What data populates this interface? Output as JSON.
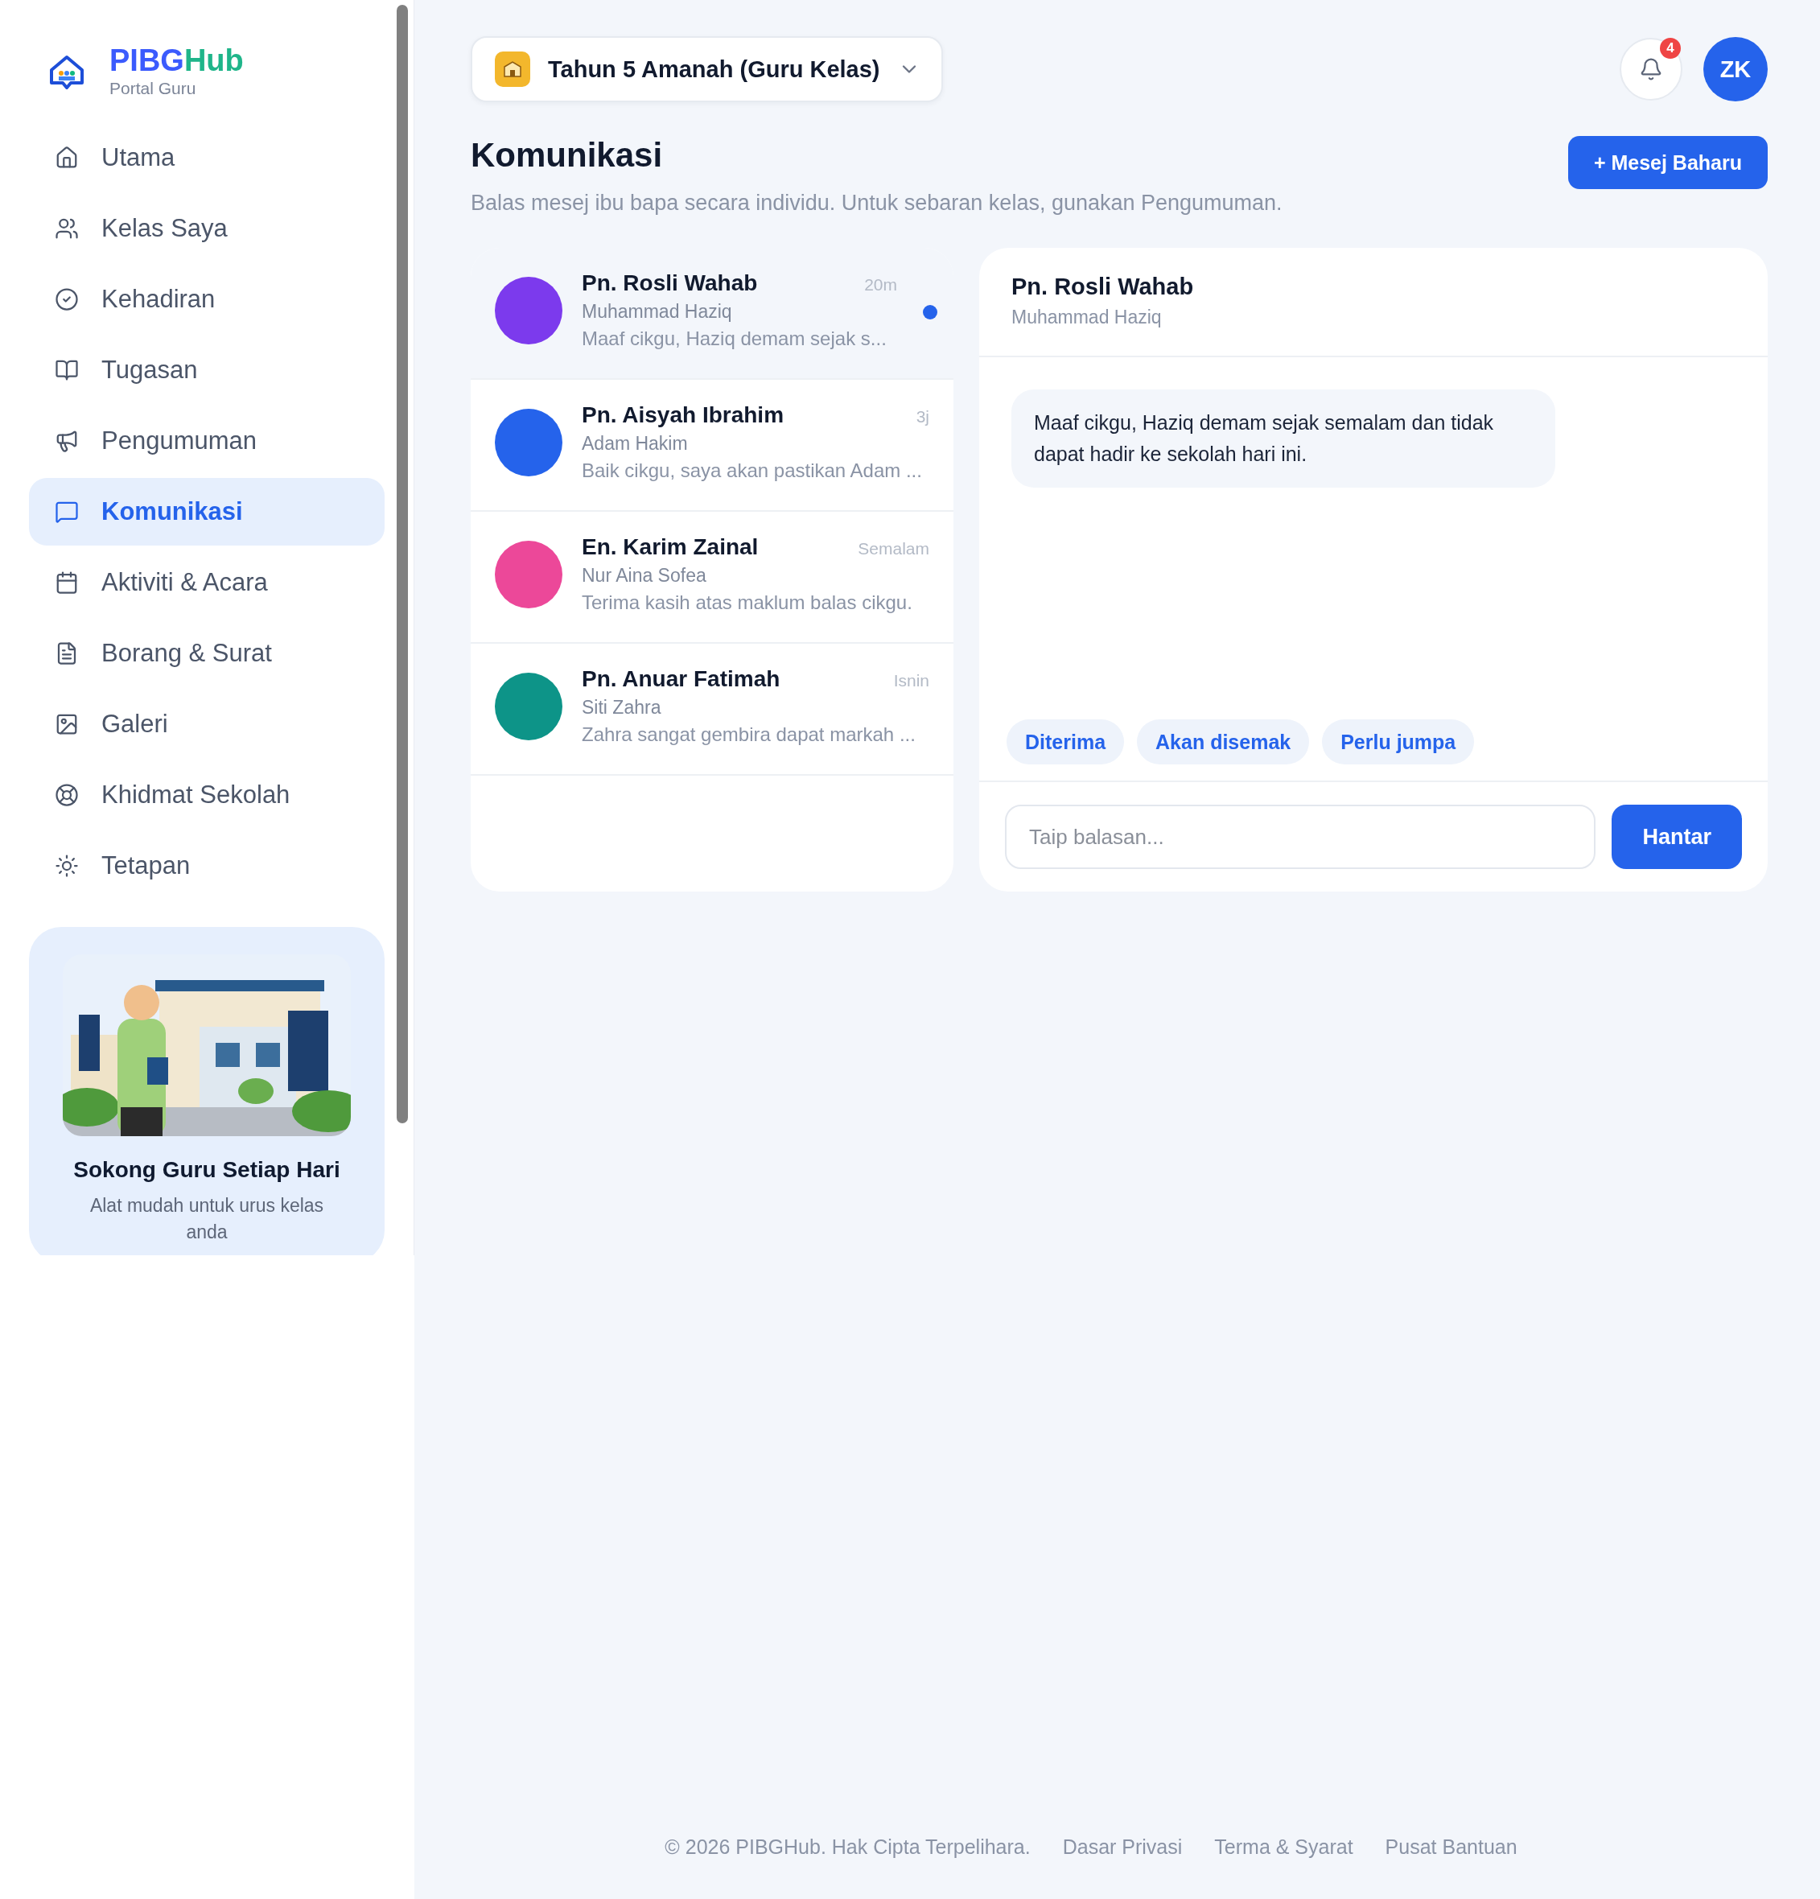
{
  "brand": {
    "name_part1": "PIBG",
    "name_part2": "Hub",
    "subtitle": "Portal Guru"
  },
  "sidebar": {
    "items": [
      {
        "label": "Utama",
        "selected": false
      },
      {
        "label": "Kelas Saya",
        "selected": false
      },
      {
        "label": "Kehadiran",
        "selected": false
      },
      {
        "label": "Tugasan",
        "selected": false
      },
      {
        "label": "Pengumuman",
        "selected": false
      },
      {
        "label": "Komunikasi",
        "selected": true
      },
      {
        "label": "Aktiviti & Acara",
        "selected": false
      },
      {
        "label": "Borang & Surat",
        "selected": false
      },
      {
        "label": "Galeri",
        "selected": false
      },
      {
        "label": "Khidmat Sekolah",
        "selected": false
      },
      {
        "label": "Tetapan",
        "selected": false
      }
    ],
    "promo": {
      "title": "Sokong Guru Setiap Hari",
      "text": "Alat mudah untuk urus kelas anda"
    }
  },
  "topbar": {
    "class_selector": "Tahun 5 Amanah (Guru Kelas)",
    "notification_count": "4",
    "avatar": "ZK"
  },
  "page": {
    "title": "Komunikasi",
    "subtitle": "Balas mesej ibu bapa secara individu. Untuk sebaran kelas, gunakan Pengumuman.",
    "new_button": "+ Mesej Baharu"
  },
  "conversations": [
    {
      "name": "Pn. Rosli Wahab",
      "student": "Muhammad Haziq",
      "preview": "Maaf cikgu, Haziq demam sejak s...",
      "time": "20m",
      "color": "#7c3aed",
      "selected": true,
      "unread": true
    },
    {
      "name": "Pn. Aisyah Ibrahim",
      "student": "Adam Hakim",
      "preview": "Baik cikgu, saya akan pastikan Adam ...",
      "time": "3j",
      "color": "#2563eb",
      "selected": false,
      "unread": false
    },
    {
      "name": "En. Karim Zainal",
      "student": "Nur Aina Sofea",
      "preview": "Terima kasih atas maklum balas cikgu.",
      "time": "Semalam",
      "color": "#ec4899",
      "selected": false,
      "unread": false
    },
    {
      "name": "Pn. Anuar Fatimah",
      "student": "Siti Zahra",
      "preview": "Zahra sangat gembira dapat markah ...",
      "time": "Isnin",
      "color": "#0d9488",
      "selected": false,
      "unread": false
    }
  ],
  "chat": {
    "name": "Pn. Rosli Wahab",
    "student": "Muhammad Haziq",
    "messages": [
      "Maaf cikgu, Haziq demam sejak semalam dan tidak dapat hadir ke sekolah hari ini."
    ],
    "quick_replies": [
      "Diterima",
      "Akan disemak",
      "Perlu jumpa"
    ],
    "reply": {
      "placeholder": "Taip balasan..."
    },
    "send_button": "Hantar"
  },
  "footer": {
    "copyright": "© 2026 PIBGHub. Hak Cipta Terpelihara.",
    "links": [
      "Dasar Privasi",
      "Terma & Syarat",
      "Pusat Bantuan"
    ]
  }
}
